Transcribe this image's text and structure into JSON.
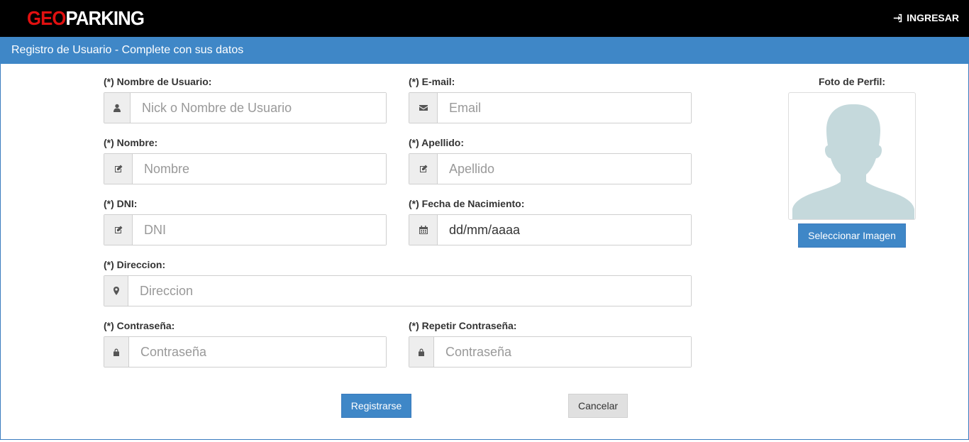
{
  "navbar": {
    "logo_part1": "GEO",
    "logo_part2": "PARKING",
    "login_label": "INGRESAR",
    "login_icon": "sign-in-icon"
  },
  "panel": {
    "title": "Registro de Usuario - Complete con sus datos"
  },
  "form": {
    "username": {
      "label": "(*) Nombre de Usuario:",
      "placeholder": "Nick o Nombre de Usuario",
      "icon": "user-icon"
    },
    "email": {
      "label": "(*) E-mail:",
      "placeholder": "Email",
      "icon": "envelope-icon"
    },
    "first_name": {
      "label": "(*) Nombre:",
      "placeholder": "Nombre",
      "icon": "edit-icon"
    },
    "last_name": {
      "label": "(*) Apellido:",
      "placeholder": "Apellido",
      "icon": "edit-icon"
    },
    "dni": {
      "label": "(*) DNI:",
      "placeholder": "DNI",
      "icon": "edit-icon"
    },
    "birth_date": {
      "label": "(*) Fecha de Nacimiento:",
      "value": "dd/mm/aaaa",
      "icon": "calendar-icon"
    },
    "address": {
      "label": "(*) Direccion:",
      "placeholder": "Direccion",
      "icon": "map-marker-icon"
    },
    "password": {
      "label": "(*) Contraseña:",
      "placeholder": "Contraseña",
      "icon": "lock-icon"
    },
    "password_repeat": {
      "label": "(*) Repetir Contraseña:",
      "placeholder": "Contraseña",
      "icon": "lock-icon"
    }
  },
  "profile": {
    "label": "Foto de Perfil:",
    "select_button": "Seleccionar Imagen"
  },
  "actions": {
    "register": "Registrarse",
    "cancel": "Cancelar"
  },
  "colors": {
    "navbar": "#000000",
    "primary": "#3f87c7",
    "logo_red": "#e01010",
    "avatar": "#c5d9dc"
  }
}
